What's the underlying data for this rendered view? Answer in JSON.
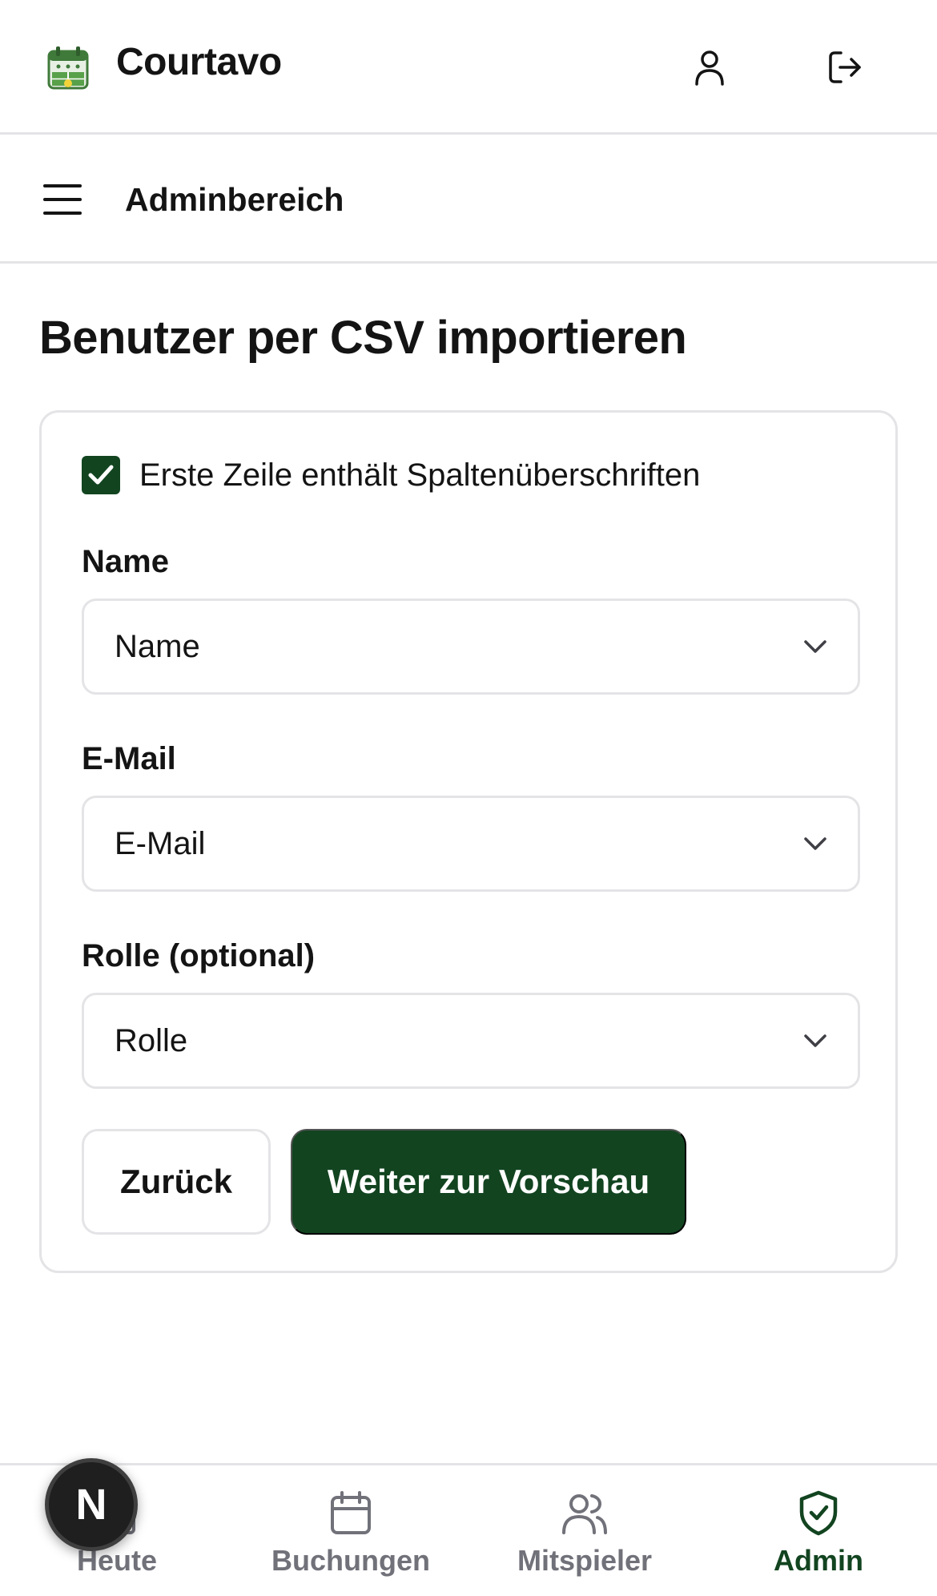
{
  "header": {
    "app_title": "Courtavo",
    "logo_icon": "calendar-court-logo",
    "profile_icon": "user-icon",
    "logout_icon": "logout-icon"
  },
  "subheader": {
    "menu_icon": "hamburger-menu-icon",
    "title": "Adminbereich"
  },
  "page": {
    "title": "Benutzer per CSV importieren"
  },
  "form": {
    "header_row_checkbox": {
      "checked": true,
      "label": "Erste Zeile enthält Spaltenüberschriften"
    },
    "fields": [
      {
        "label": "Name",
        "value": "Name"
      },
      {
        "label": "E-Mail",
        "value": "E-Mail"
      },
      {
        "label": "Rolle (optional)",
        "value": "Rolle"
      }
    ],
    "back_label": "Zurück",
    "next_label": "Weiter zur Vorschau"
  },
  "bottom_nav": {
    "items": [
      {
        "label": "Heute",
        "icon": "home-icon",
        "active": false
      },
      {
        "label": "Buchungen",
        "icon": "calendar-icon",
        "active": false
      },
      {
        "label": "Mitspieler",
        "icon": "users-icon",
        "active": false
      },
      {
        "label": "Admin",
        "icon": "shield-check-icon",
        "active": true
      }
    ]
  },
  "dev_badge": {
    "letter": "N"
  },
  "colors": {
    "brand_green": "#124420",
    "border": "#e4e4e7",
    "text": "#141414",
    "muted": "#71717a"
  }
}
